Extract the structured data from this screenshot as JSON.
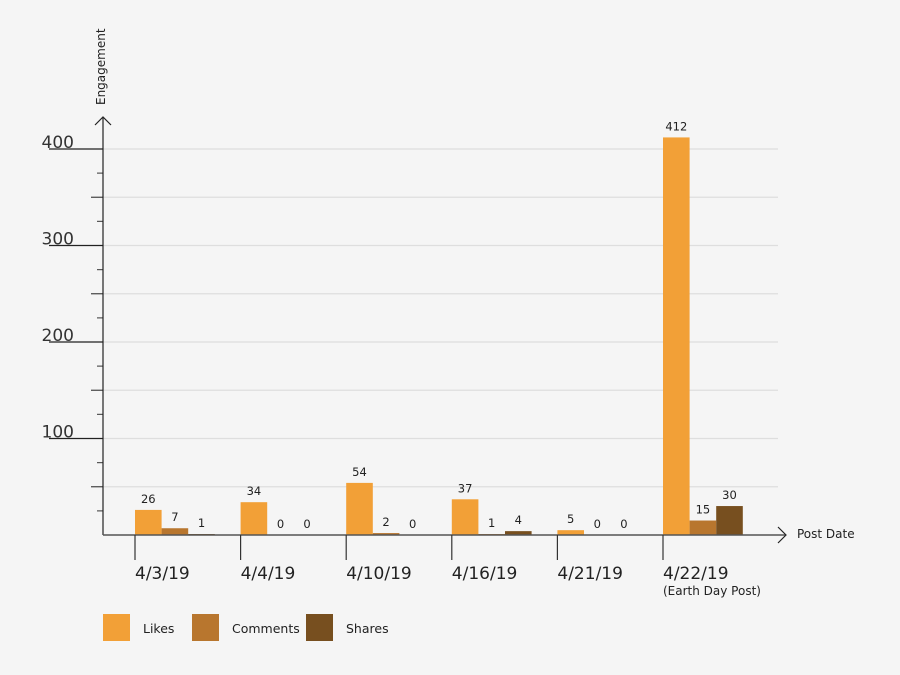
{
  "chart_data": {
    "type": "bar",
    "title": "",
    "xlabel": "Post Date",
    "ylabel": "Engagement",
    "ylim": [
      0,
      400
    ],
    "y_ticks": [
      100,
      200,
      300,
      400
    ],
    "y_tick_labels": [
      "100",
      "200",
      "300",
      "400"
    ],
    "grid": true,
    "legend_position": "bottom-left",
    "categories": [
      "4/3/19",
      "4/4/19",
      "4/10/19",
      "4/16/19",
      "4/21/19",
      "4/22/19"
    ],
    "category_sublabels": [
      "",
      "",
      "",
      "",
      "",
      "(Earth Day Post)"
    ],
    "series": [
      {
        "name": "Likes",
        "color": "#f2a037",
        "values": [
          26,
          34,
          54,
          37,
          5,
          412
        ]
      },
      {
        "name": "Comments",
        "color": "#b8762e",
        "values": [
          7,
          0,
          2,
          1,
          0,
          15
        ]
      },
      {
        "name": "Shares",
        "color": "#774f1f",
        "values": [
          1,
          0,
          0,
          4,
          0,
          30
        ]
      }
    ]
  }
}
